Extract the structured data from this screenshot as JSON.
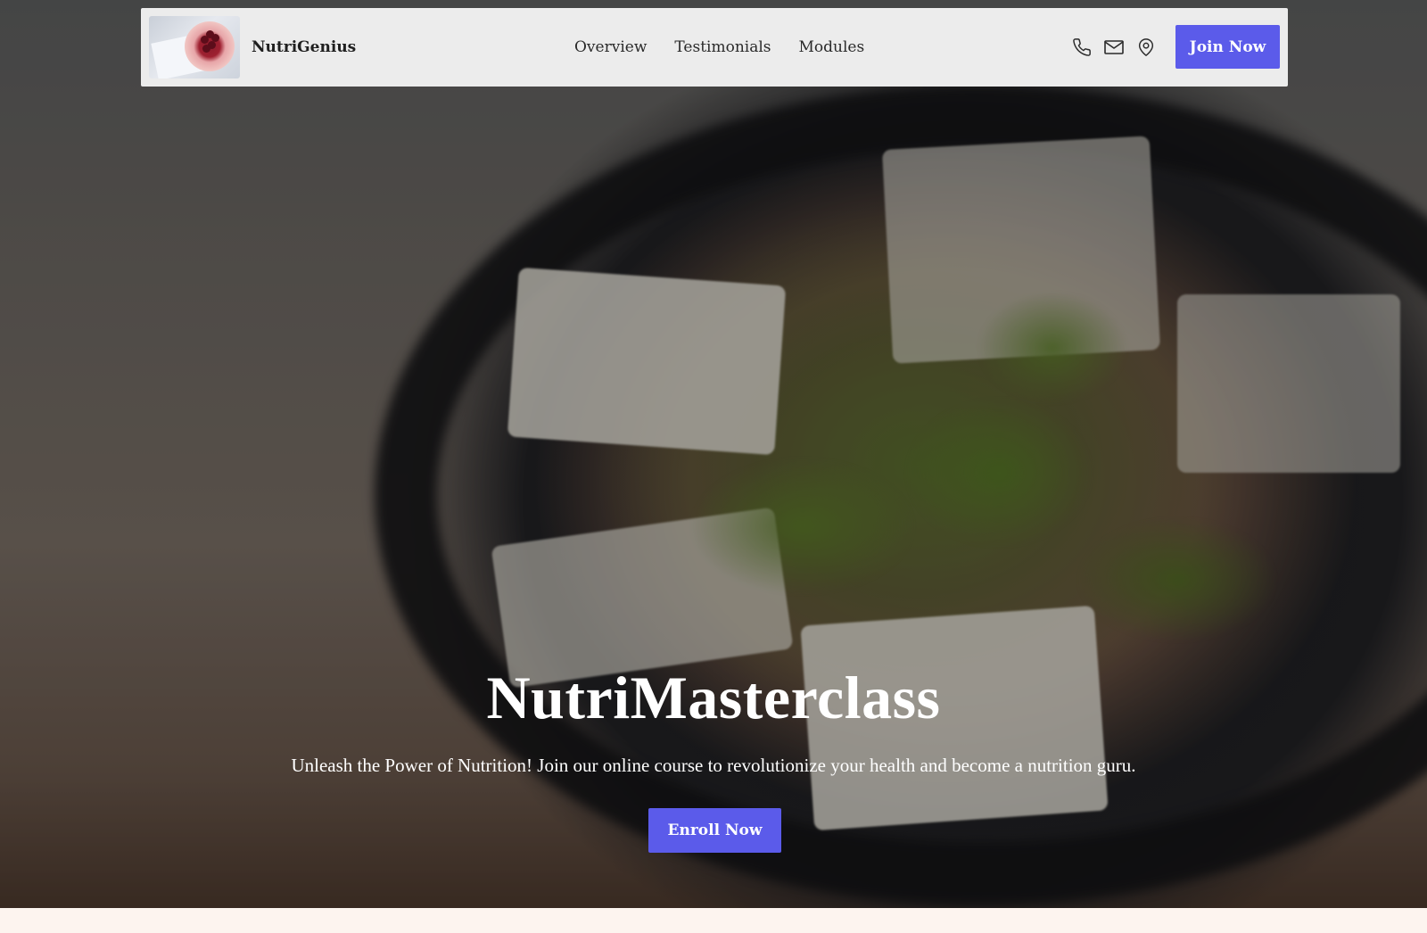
{
  "navbar": {
    "brand": "NutriGenius",
    "links": [
      "Overview",
      "Testimonials",
      "Modules"
    ],
    "icons": [
      "phone-icon",
      "mail-icon",
      "map-pin-icon"
    ],
    "cta_label": "Join Now"
  },
  "hero": {
    "title": "NutriMasterclass",
    "subtitle": "Unleash the Power of Nutrition! Join our online course to revolutionize your health and become a nutrition guru.",
    "cta_label": "Enroll Now"
  },
  "colors": {
    "accent": "#5b5bea",
    "navbar_bg": "#ececec",
    "page_bg": "#fdf4ef"
  }
}
